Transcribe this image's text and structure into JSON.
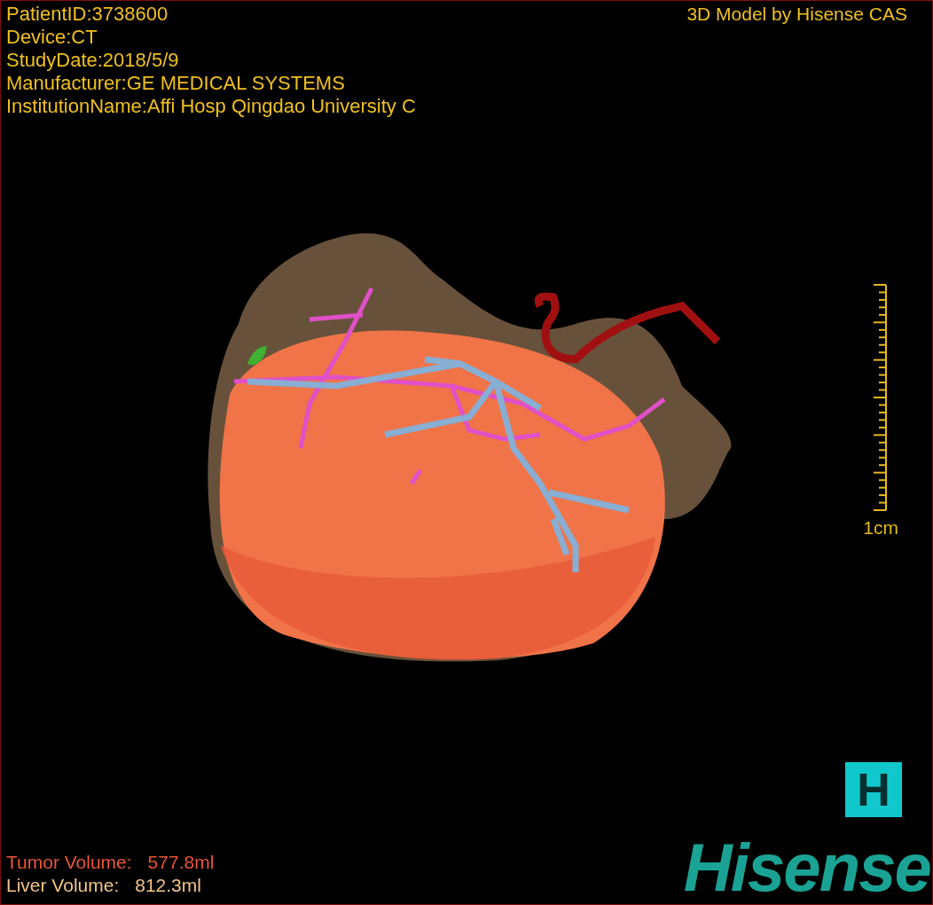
{
  "patient_info": [
    "PatientID:3738600",
    "Device:CT",
    "StudyDate:2018/5/9",
    "Manufacturer:GE MEDICAL SYSTEMS",
    "InstitutionName:Affi Hosp Qingdao University C"
  ],
  "model_credit": "3D Model by Hisense CAS",
  "scale_bar": {
    "label": "1cm"
  },
  "volumes": [
    {
      "label": "Tumor Volume:",
      "value": "577.8ml",
      "color": "#e8553a"
    },
    {
      "label": "Liver Volume:",
      "value": "812.3ml",
      "color": "#f2c48a"
    }
  ],
  "logo": {
    "badge": "H",
    "wordmark": "Hisense"
  }
}
